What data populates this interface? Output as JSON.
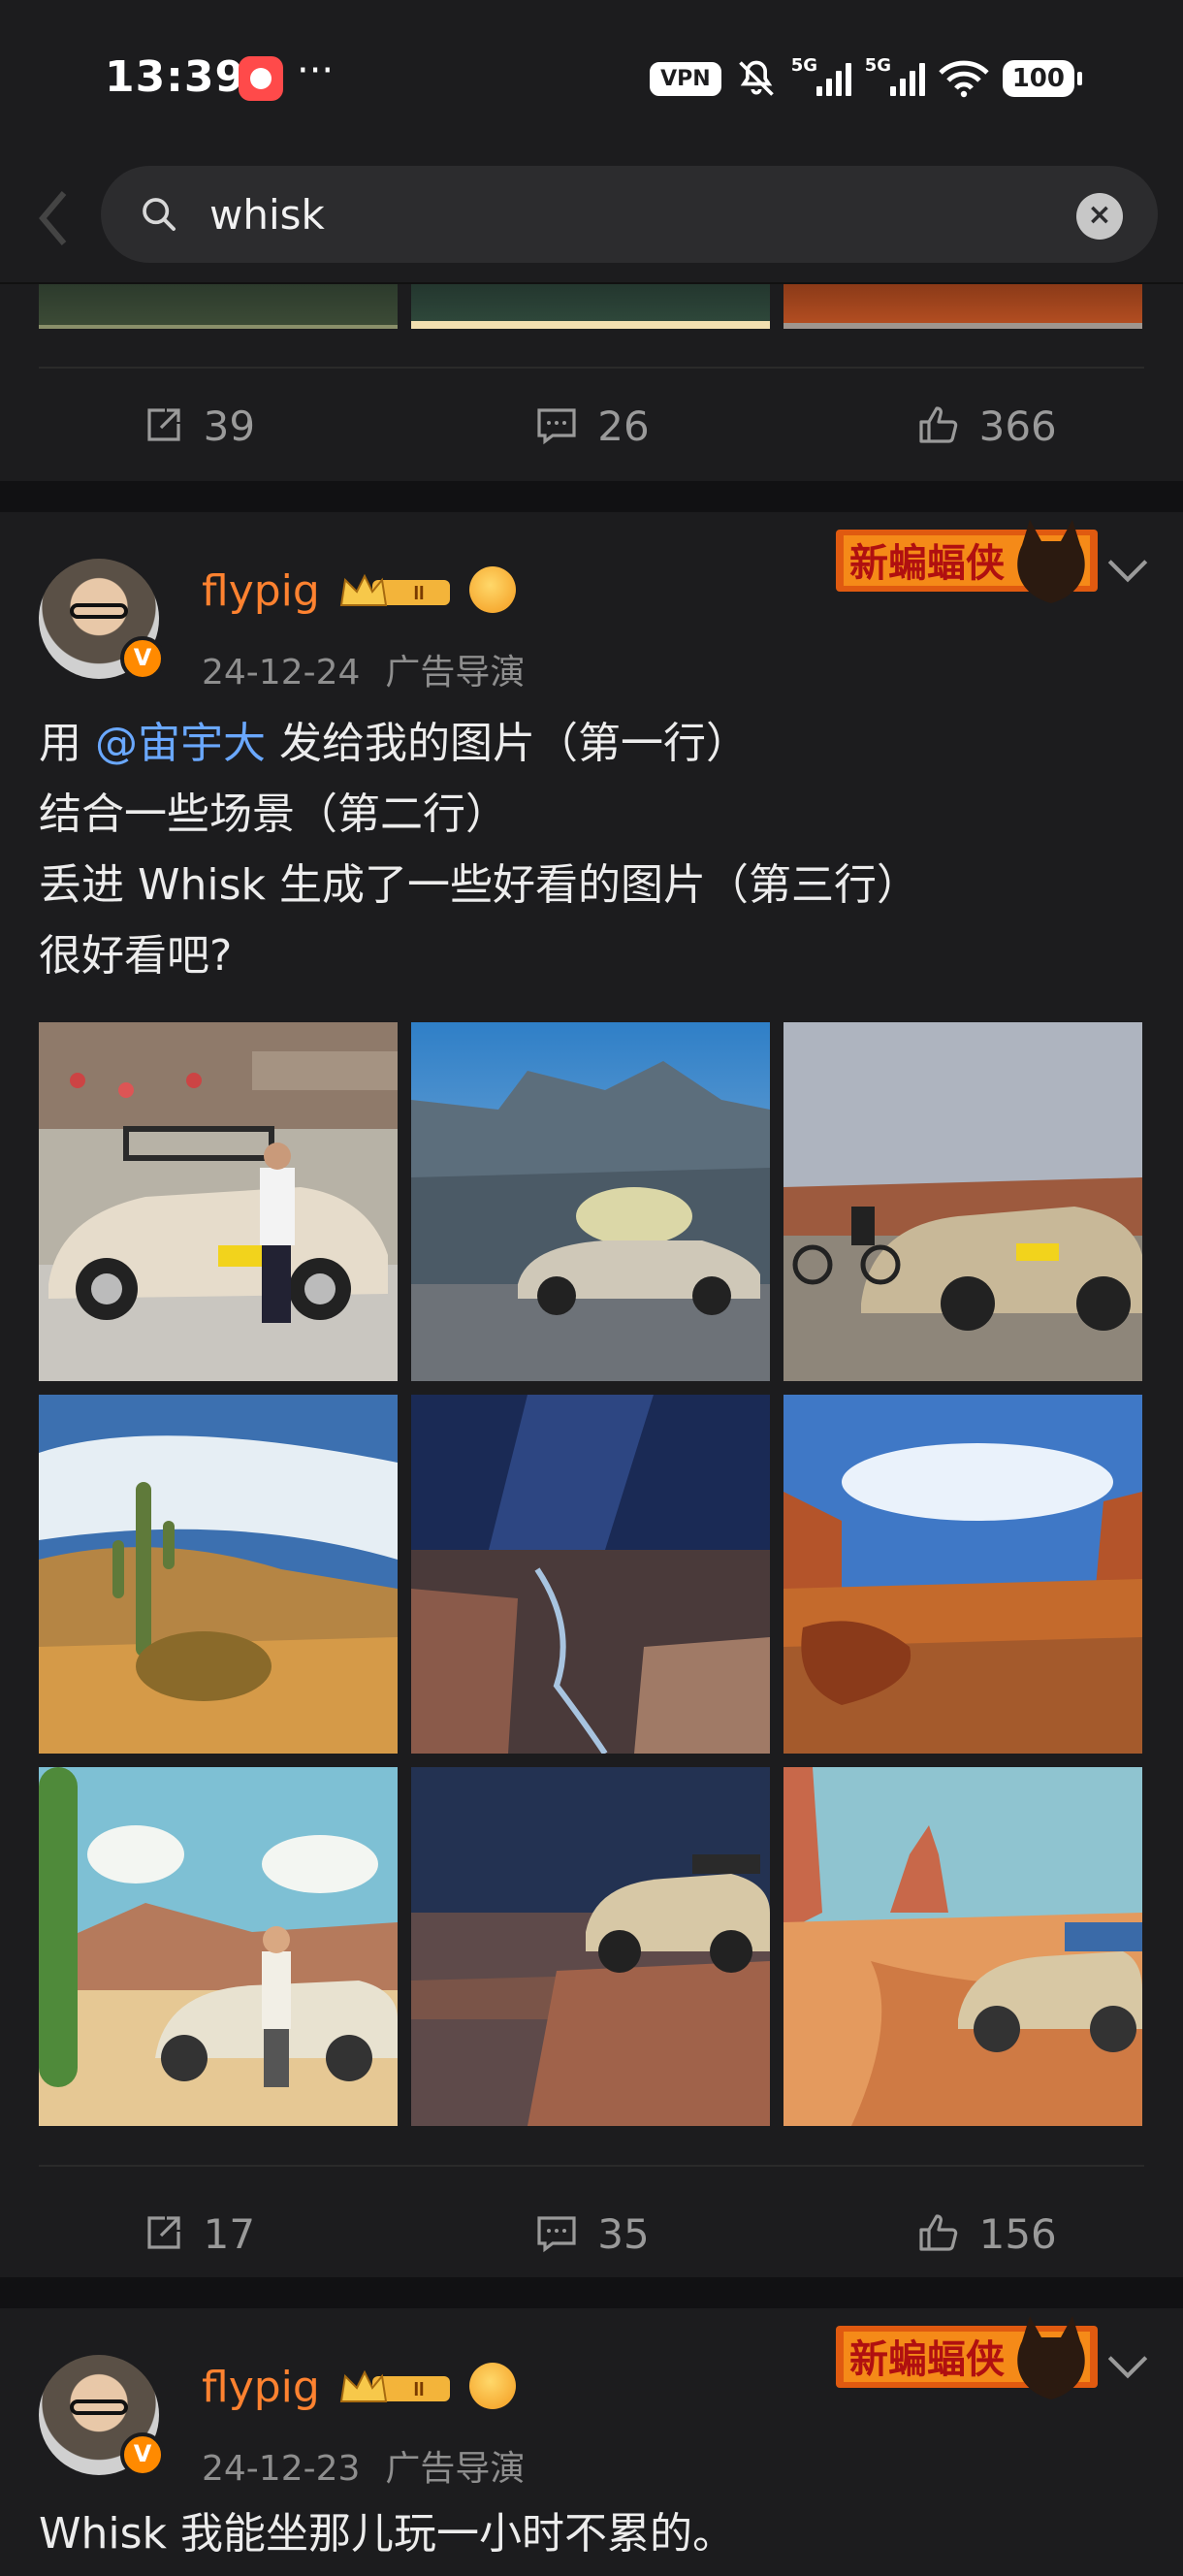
{
  "status_bar": {
    "time": "13:39",
    "dots": "···",
    "vpn": "VPN",
    "signal1": "5G",
    "signal2": "5G",
    "battery": "100"
  },
  "search": {
    "query": "whisk"
  },
  "prev_post": {
    "reposts": "39",
    "comments": "26",
    "likes": "366"
  },
  "posts": [
    {
      "username": "flypig",
      "level": "II",
      "date": "24-12-24",
      "source": "广告导演",
      "promo_text": "新蝙蝠侠",
      "text_line1_pre": "用 ",
      "mention": "@宙宇大",
      "text_line1_post": " 发给我的图片（第一行）",
      "text_line2": "结合一些场景（第二行）",
      "text_line3": "丢进 Whisk 生成了一些好看的图片（第三行）",
      "text_line4": "很好看吧?",
      "reposts": "17",
      "comments": "35",
      "likes": "156"
    },
    {
      "username": "flypig",
      "level": "II",
      "date": "24-12-23",
      "source": "广告导演",
      "promo_text": "新蝙蝠侠",
      "text_line1": "Whisk 我能坐那儿玩一小时不累的。"
    }
  ],
  "colors": {
    "background": "#1c1c1e",
    "username": "#ff8230",
    "mention": "#6aa8ff",
    "meta": "#8e8e8e"
  }
}
